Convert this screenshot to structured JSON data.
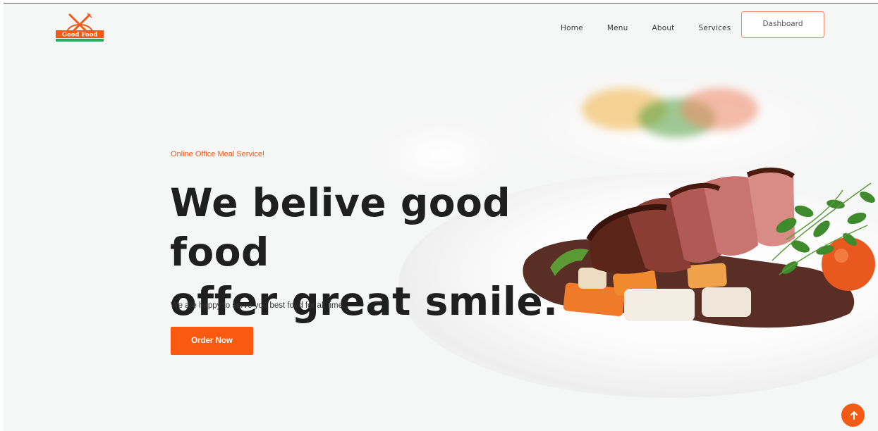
{
  "brand": {
    "logo_text": "Good Food",
    "logo_icon": "crossed-fork-knife-icon"
  },
  "nav": {
    "items": [
      {
        "label": "Home"
      },
      {
        "label": "Menu"
      },
      {
        "label": "About"
      },
      {
        "label": "Services"
      }
    ],
    "dashboard_label": "Dashboard"
  },
  "hero": {
    "eyebrow": "Online Office Meal Service!",
    "headline_line1": "We belive good food",
    "headline_line2": "offer great smile.",
    "subtitle": "We are happy to serve you best food for all time.",
    "cta_label": "Order Now",
    "image": "plated-steak-with-vegetables"
  },
  "scroll_top": {
    "icon": "arrow-up-icon"
  },
  "colors": {
    "accent": "#fa5a0f",
    "accent_border": "#ef8a65",
    "logo_green": "#3aa35a",
    "text_dark": "#1f1f1f",
    "background": "#f5f6f6"
  }
}
